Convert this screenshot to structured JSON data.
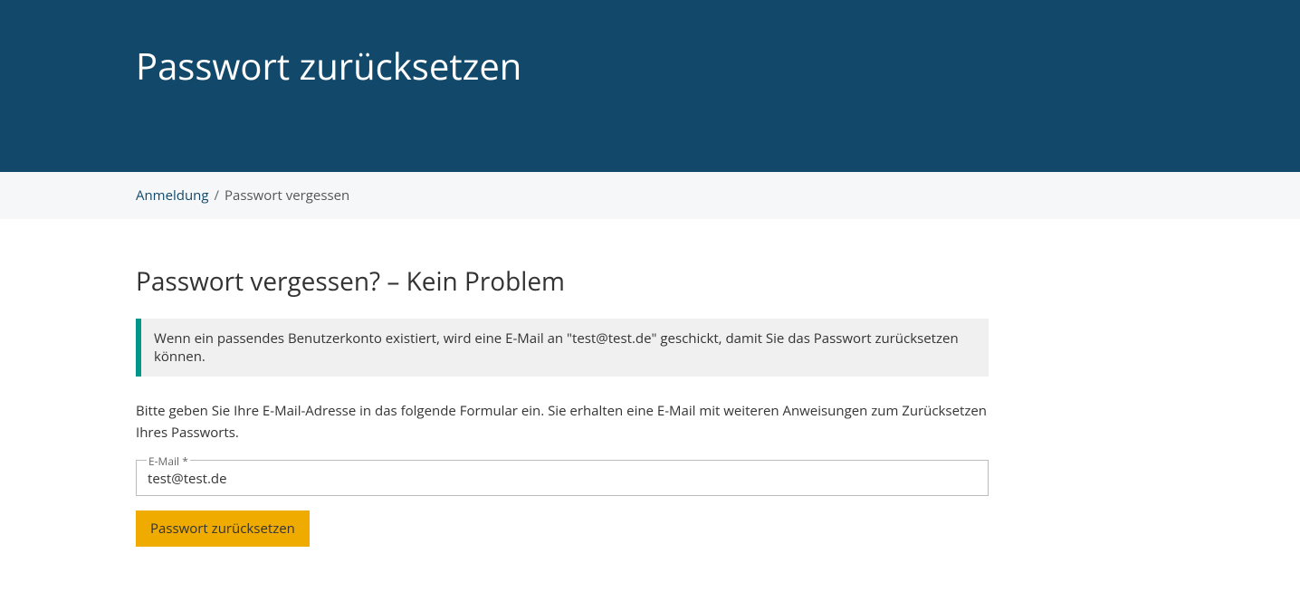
{
  "header": {
    "title": "Passwort zurücksetzen"
  },
  "breadcrumb": {
    "link_label": "Anmeldung",
    "separator": "/",
    "current": "Passwort vergessen"
  },
  "main": {
    "heading": "Passwort vergessen? – Kein Problem",
    "alert_text": "Wenn ein passendes Benutzerkonto existiert, wird eine E-Mail an \"test@test.de\" geschickt, damit Sie das Passwort zurücksetzen können.",
    "instruction": "Bitte geben Sie Ihre E-Mail-Adresse in das folgende Formular ein. Sie erhalten eine E-Mail mit weiteren Anweisungen zum Zurücksetzen Ihres Passworts.",
    "email_label": "E-Mail",
    "required_marker": "*",
    "email_value": "test@test.de",
    "submit_label": "Passwort zurücksetzen"
  }
}
